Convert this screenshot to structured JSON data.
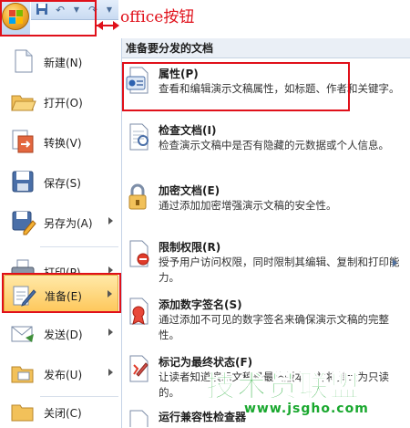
{
  "annotation": {
    "office_label": "office按钮"
  },
  "quick_access": {
    "save_icon": "save-icon",
    "undo_icon": "undo-icon",
    "redo_icon": "redo-icon",
    "dropdown_icon": "chevron-down-icon"
  },
  "left_menu": {
    "items": [
      {
        "label": "新建(N)",
        "icon": "new-document-icon"
      },
      {
        "label": "打开(O)",
        "icon": "open-folder-icon"
      },
      {
        "label": "转换(V)",
        "icon": "convert-icon"
      },
      {
        "label": "保存(S)",
        "icon": "save-icon"
      },
      {
        "label": "另存为(A)",
        "icon": "save-as-icon",
        "submenu": true
      },
      {
        "label": "打印(P)",
        "icon": "print-icon",
        "submenu": true
      },
      {
        "label": "准备(E)",
        "icon": "prepare-icon",
        "submenu": true,
        "active": true
      },
      {
        "label": "发送(D)",
        "icon": "send-icon",
        "submenu": true
      },
      {
        "label": "发布(U)",
        "icon": "publish-icon",
        "submenu": true
      },
      {
        "label": "关闭(C)",
        "icon": "close-folder-icon"
      }
    ]
  },
  "panel": {
    "header": "准备要分发的文档",
    "items": [
      {
        "title": "属性(P)",
        "desc": "查看和编辑演示文稿属性，如标题、作者和关键字。",
        "icon": "properties-icon"
      },
      {
        "title": "检查文档(I)",
        "desc": "检查演示文稿中是否有隐藏的元数据或个人信息。",
        "icon": "inspect-document-icon"
      },
      {
        "title": "加密文档(E)",
        "desc": "通过添加加密增强演示文稿的安全性。",
        "icon": "encrypt-lock-icon"
      },
      {
        "title": "限制权限(R)",
        "desc": "授予用户访问权限，同时限制其编辑、复制和打印能力。",
        "icon": "restrict-permission-icon",
        "submenu": true
      },
      {
        "title": "添加数字签名(S)",
        "desc": "通过添加不可见的数字签名来确保演示文稿的完整性。",
        "icon": "digital-signature-icon"
      },
      {
        "title": "标记为最终状态(F)",
        "desc": "让读者知道演示文稿是最终版本，并将其设为只读的。",
        "icon": "mark-final-icon"
      },
      {
        "title": "运行兼容性检查器",
        "desc": "",
        "icon": "compatibility-checker-icon"
      }
    ]
  },
  "watermark": {
    "text": "技术员联盟",
    "url": "www.jsgho.com"
  },
  "colors": {
    "highlight": "#e0101a",
    "active_item": "#fec75a",
    "watermark": "#1aa82f"
  }
}
